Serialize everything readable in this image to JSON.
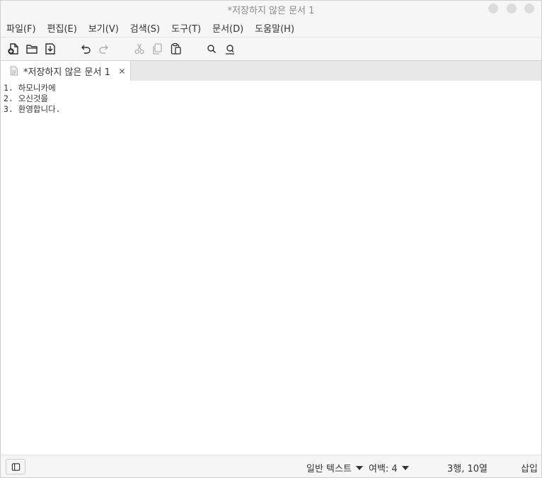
{
  "window": {
    "title": "*저장하지 않은 문서 1"
  },
  "menubar": {
    "items": [
      "파일(F)",
      "편집(E)",
      "보기(V)",
      "검색(S)",
      "도구(T)",
      "문서(D)",
      "도움말(H)"
    ]
  },
  "toolbar": {
    "icons": [
      "new-document-icon",
      "open-folder-icon",
      "save-icon",
      "undo-icon",
      "redo-icon",
      "cut-icon",
      "copy-icon",
      "paste-icon",
      "search-icon",
      "replace-icon"
    ]
  },
  "tabs": [
    {
      "label": "*저장하지 않은 문서 1",
      "icon": "text-document-icon"
    }
  ],
  "editor": {
    "lines": [
      "1. 하모니카에",
      "2. 오신것을",
      "3. 환영합니다."
    ]
  },
  "statusbar": {
    "language": "일반 텍스트",
    "tab_width": "여백: 4",
    "cursor_position": "3행, 10열",
    "insert_mode": "삽입"
  },
  "colors": {
    "background": "#f6f6f6",
    "editor_background": "#ffffff",
    "title_text": "#8a8a8a"
  }
}
